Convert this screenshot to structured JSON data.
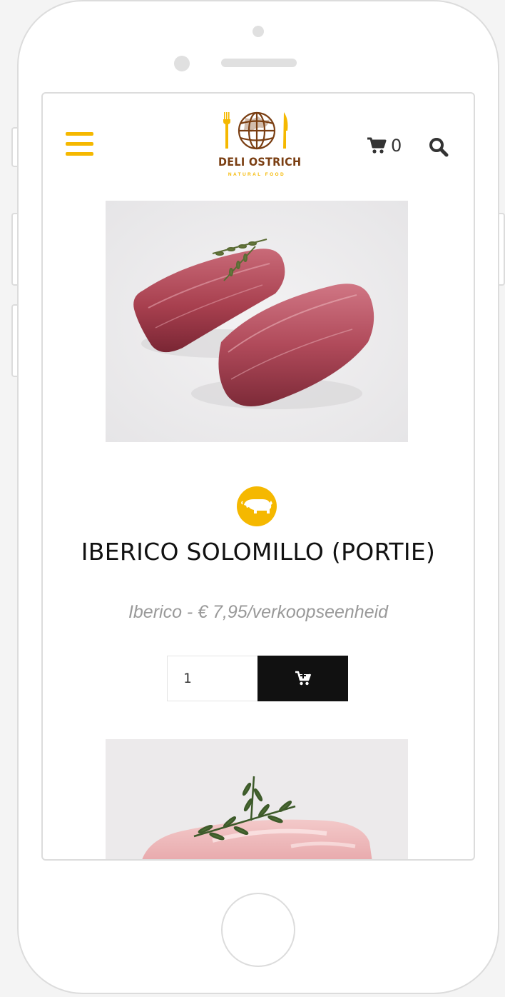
{
  "header": {
    "logo": {
      "name": "DELI OSTRICH",
      "tagline": "NATURAL FOOD"
    },
    "cart": {
      "count": "0"
    }
  },
  "product": {
    "category_icon": "pig-icon",
    "title": "IBERICO SOLOMILLO (PORTIE)",
    "subtitle": "Iberico - € 7,95/verkoopseenheid",
    "quantity": "1"
  },
  "colors": {
    "accent": "#f5b800",
    "logo_brown": "#7a3e12",
    "button": "#111111",
    "subtitle": "#999999"
  }
}
